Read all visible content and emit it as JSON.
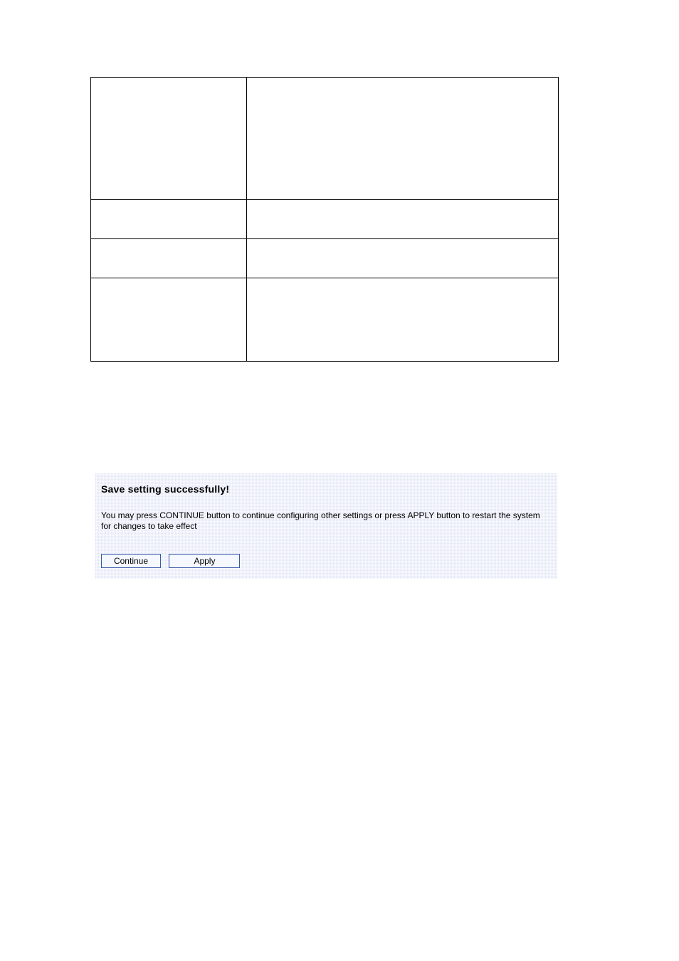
{
  "table": {
    "rows": [
      {
        "param": "",
        "desc": ""
      },
      {
        "param": "",
        "desc": ""
      },
      {
        "param": "",
        "desc": ""
      },
      {
        "param": "",
        "desc": ""
      }
    ]
  },
  "savePanel": {
    "title": "Save setting successfully!",
    "description": "You may press CONTINUE button to continue configuring other settings or press APPLY button to restart the system for changes to take effect",
    "continueLabel": "Continue",
    "applyLabel": "Apply"
  }
}
